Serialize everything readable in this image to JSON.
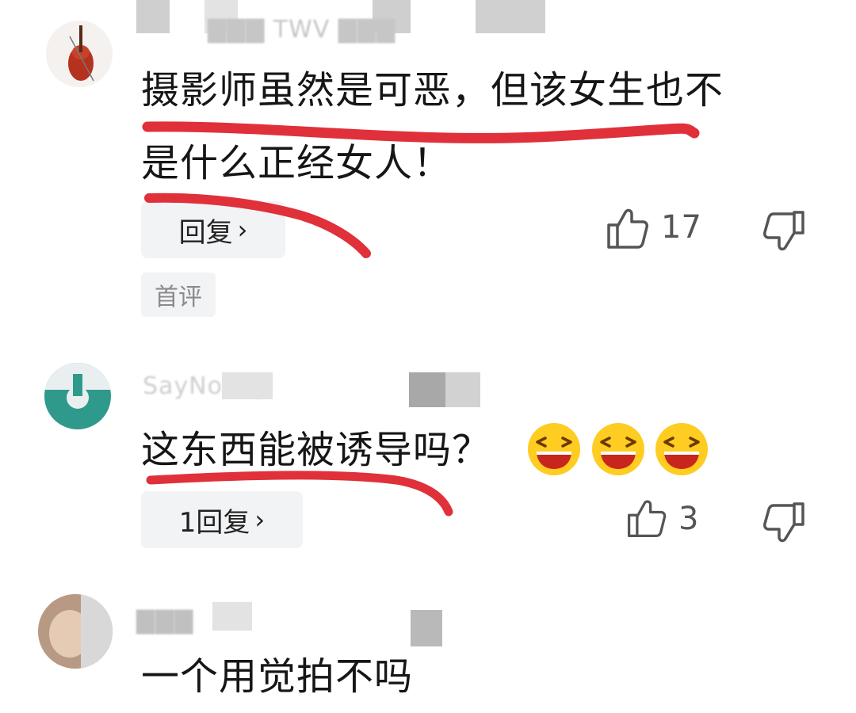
{
  "comments": [
    {
      "username": "▇▇▇ TWV ▇▇▇",
      "text_line1": "摄影师虽然是可恶，但该女生也不",
      "text_line2": "是什么正经女人！",
      "reply_label": "回复",
      "like_count": "17",
      "badge": "首评"
    },
    {
      "username": "SayNoSay",
      "text": "这东西能被诱导吗？",
      "reply_label": "1回复",
      "like_count": "3",
      "emoji_count": 3
    },
    {
      "username": "▇▇▇",
      "text_partial": "一个用觉拍不吗"
    }
  ],
  "icons": {
    "like": "thumbs-up-icon",
    "dislike": "thumbs-down-icon",
    "chevron": "chevron-right-icon",
    "emoji": "laughing-face-emoji"
  },
  "colors": {
    "underline": "#e0303a",
    "reply_bg": "#f2f3f5",
    "emoji_face": "#ffcc22"
  }
}
